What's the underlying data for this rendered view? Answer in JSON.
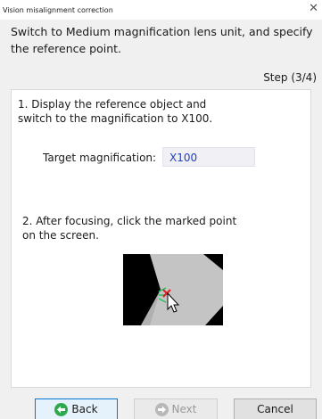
{
  "window": {
    "title": "Vision misalignment correction",
    "close_glyph": "✕"
  },
  "header": {
    "instruction": "Switch to Medium magnification lens unit, and specify the reference point.",
    "step": "Step (3/4)"
  },
  "panel": {
    "instruction1": "1. Display the reference object and\nswitch to the magnification to X100.",
    "target_label": "Target magnification:",
    "target_value": "X100",
    "instruction2": "2. After focusing, click the marked point\non the screen."
  },
  "buttons": {
    "back": "Back",
    "next": "Next",
    "cancel": "Cancel"
  },
  "icons": {
    "back": "arrow-left-circle-icon",
    "next": "arrow-right-circle-icon",
    "close": "close-icon"
  },
  "colors": {
    "back_icon": "#2fa84f",
    "next_icon": "#b8b8b8",
    "target_text": "#1f3fbf",
    "marker": "#e02020"
  }
}
